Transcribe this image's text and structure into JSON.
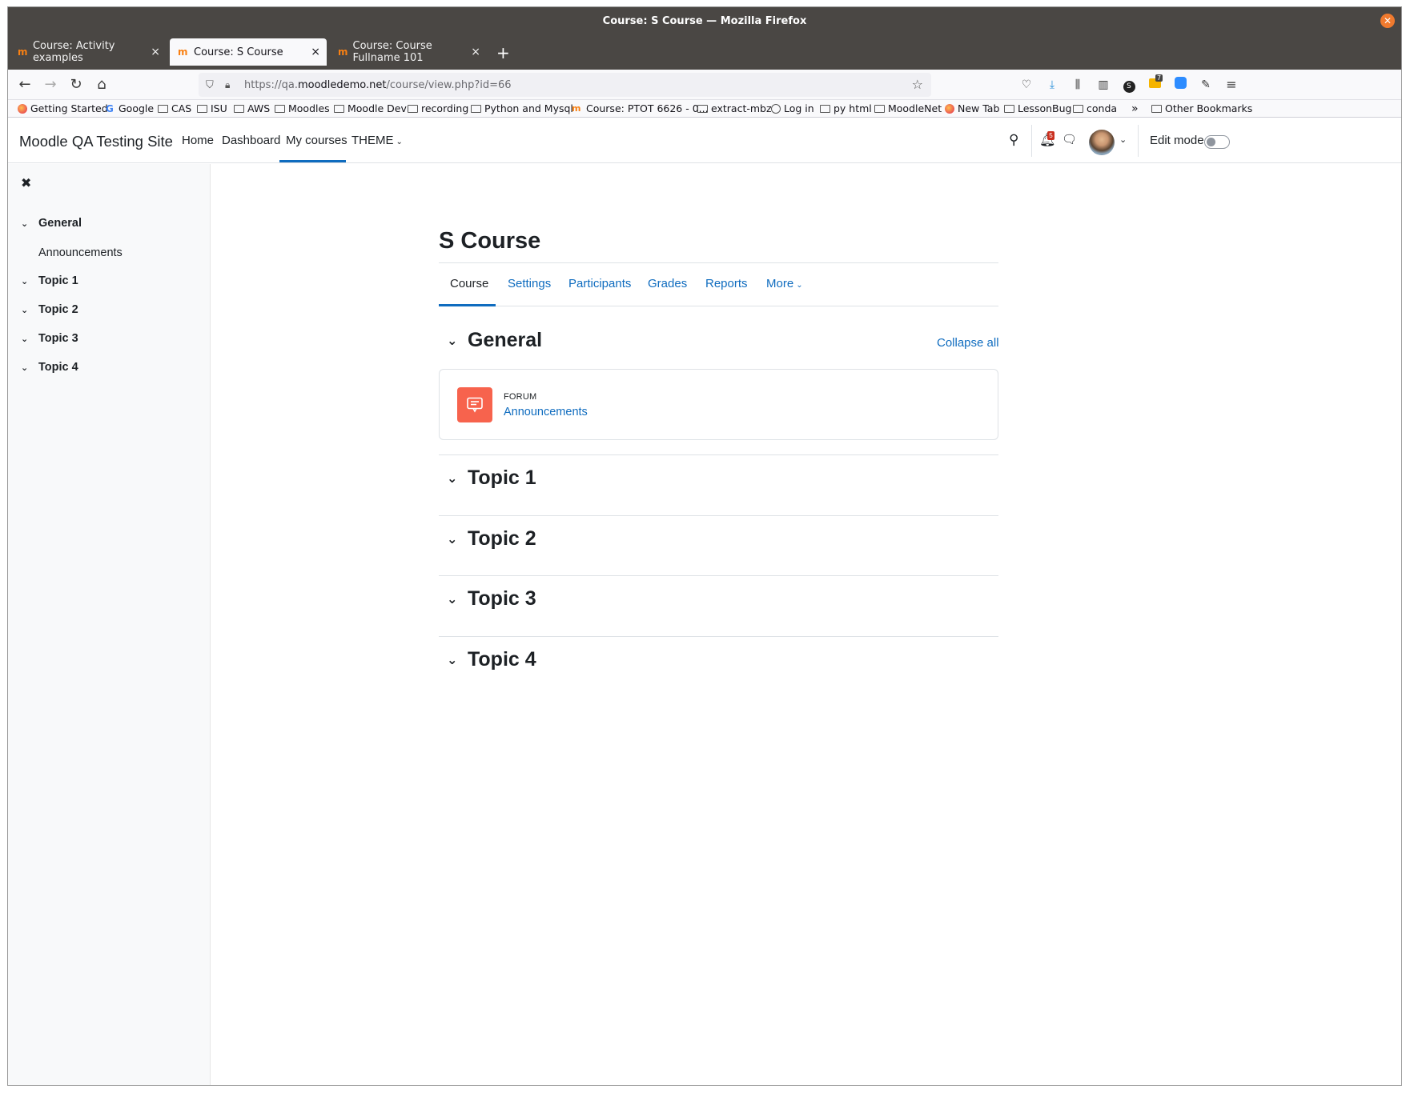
{
  "window": {
    "title": "Course: S Course — Mozilla Firefox",
    "close_glyph": "✕"
  },
  "tabs": [
    {
      "label": "Course: Activity examples"
    },
    {
      "label": "Course: S Course"
    },
    {
      "label": "Course: Course Fullname 101"
    }
  ],
  "navbar": {
    "url_host_prefix": "https://qa.",
    "url_host_main": "moodledemo.net",
    "url_path": "/course/view.php?id=66"
  },
  "bookmarks": [
    {
      "label": "Getting Started",
      "icon": "firefox-icon"
    },
    {
      "label": "Google",
      "icon": "google-icon"
    },
    {
      "label": "CAS",
      "icon": "folder-icon"
    },
    {
      "label": "ISU",
      "icon": "folder-icon"
    },
    {
      "label": "AWS",
      "icon": "folder-icon"
    },
    {
      "label": "Moodles",
      "icon": "folder-icon"
    },
    {
      "label": "Moodle Dev",
      "icon": "folder-icon"
    },
    {
      "label": "recording",
      "icon": "folder-icon"
    },
    {
      "label": "Python and Mysql",
      "icon": "folder-icon"
    },
    {
      "label": "Course: PTOT 6626 - 0...",
      "icon": "moodle-icon"
    },
    {
      "label": "extract-mbz",
      "icon": "folder-icon"
    },
    {
      "label": "Log in",
      "icon": "globe-icon"
    },
    {
      "label": "py html",
      "icon": "folder-icon"
    },
    {
      "label": "MoodleNet",
      "icon": "folder-icon"
    },
    {
      "label": "New Tab",
      "icon": "firefox-icon"
    },
    {
      "label": "LessonBug",
      "icon": "folder-icon"
    },
    {
      "label": "conda",
      "icon": "folder-icon"
    },
    {
      "label": "Other Bookmarks",
      "icon": "folder-icon"
    }
  ],
  "toolbar": {
    "extension_badge": "7"
  },
  "header": {
    "brand": "Moodle QA Testing Site",
    "nav": [
      "Home",
      "Dashboard",
      "My courses",
      "THEME"
    ],
    "notification_count": "5",
    "edit_mode_label": "Edit mode"
  },
  "drawer": {
    "sections": [
      {
        "label": "General",
        "items": [
          "Announcements"
        ]
      },
      {
        "label": "Topic 1",
        "items": []
      },
      {
        "label": "Topic 2",
        "items": []
      },
      {
        "label": "Topic 3",
        "items": []
      },
      {
        "label": "Topic 4",
        "items": []
      }
    ]
  },
  "course": {
    "title": "S Course",
    "tabs": [
      "Course",
      "Settings",
      "Participants",
      "Grades",
      "Reports",
      "More"
    ],
    "collapse_all": "Collapse all",
    "sections": [
      {
        "title": "General",
        "activities": [
          {
            "type": "FORUM",
            "name": "Announcements"
          }
        ]
      },
      {
        "title": "Topic 1"
      },
      {
        "title": "Topic 2"
      },
      {
        "title": "Topic 3"
      },
      {
        "title": "Topic 4"
      }
    ]
  },
  "help": {
    "label": "?"
  },
  "colors": {
    "accent": "#0f6cbf",
    "forum": "#f7634d",
    "titlebar": "#4a4744"
  }
}
